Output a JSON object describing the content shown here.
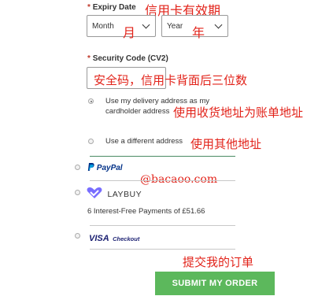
{
  "expiry": {
    "label": "Expiry Date",
    "required_mark": "*",
    "month_value": "Month",
    "year_value": "Year",
    "annotation": "信用卡有效期",
    "month_annotation": "月",
    "year_annotation": "年"
  },
  "security": {
    "label": "Security Code (CV2)",
    "required_mark": "*",
    "annotation": "安全码，信用卡背面后三位数",
    "value": ""
  },
  "billing": {
    "option_same_line1": "Use my delivery address as my",
    "option_same_line2": "cardholder address",
    "option_same_annotation": "使用收货地址为账单地址",
    "option_different": "Use a different address",
    "option_different_annotation": "使用其他地址"
  },
  "payment_methods": {
    "paypal": "PayPal",
    "laybuy_brand": "LAYBUY",
    "laybuy_info": "6 Interest-Free Payments of £51.66",
    "visa_brand": "VISA",
    "visa_sub": "Checkout"
  },
  "watermark": "@bacaoo.com",
  "submit": {
    "label": "SUBMIT MY ORDER",
    "annotation": "提交我的订单"
  },
  "colors": {
    "annotation": "#e2231a",
    "button": "#5cb85c",
    "divider_accent": "#4a8a63",
    "paypal_blue": "#003087",
    "paypal_light": "#009cde",
    "laybuy_purple": "#786dff",
    "visa_blue": "#1a1f71"
  }
}
